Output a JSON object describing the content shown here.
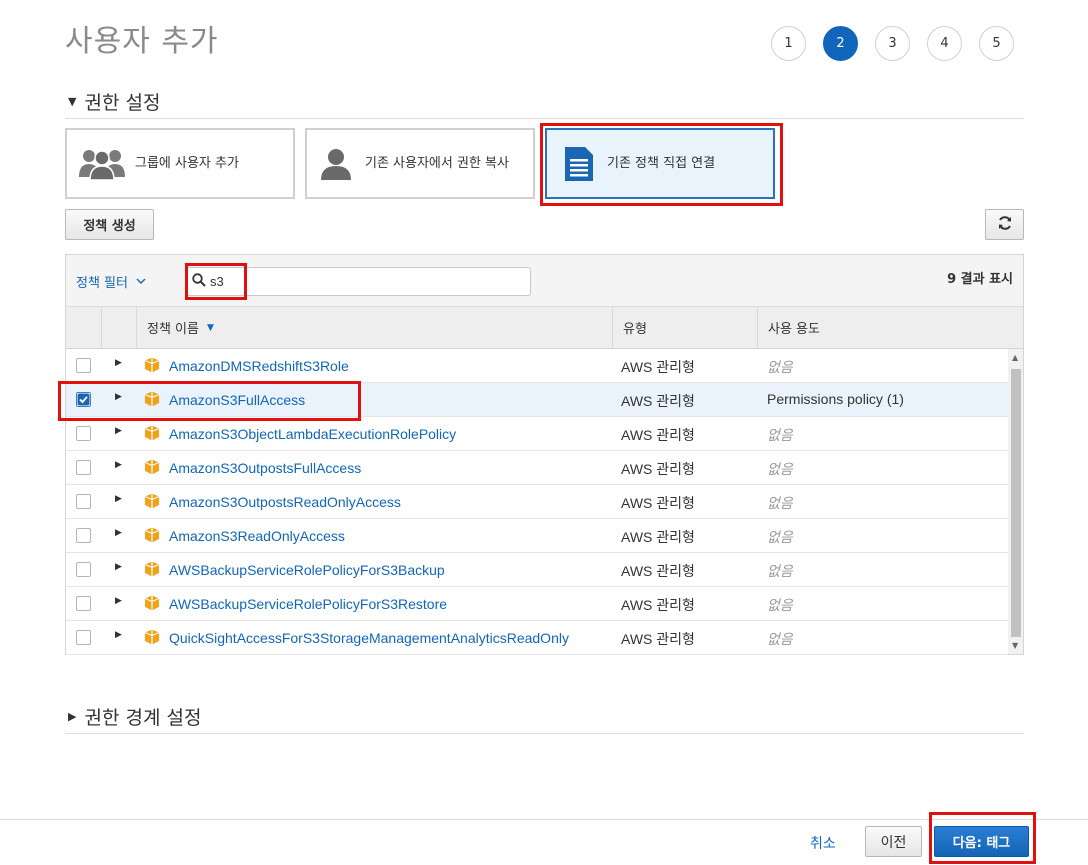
{
  "page": {
    "title": "사용자 추가"
  },
  "steps": [
    "1",
    "2",
    "3",
    "4",
    "5"
  ],
  "current_step": "2",
  "permissions": {
    "section_title": "권한 설정",
    "options": [
      {
        "label": "그룹에 사용자 추가",
        "icon": "group-icon"
      },
      {
        "label": "기존 사용자에서 권한 복사",
        "icon": "user-icon"
      },
      {
        "label": "기존 정책 직접 연결",
        "icon": "document-icon",
        "selected": true
      }
    ],
    "create_policy_label": "정책 생성",
    "refresh_icon": "refresh-icon"
  },
  "filter": {
    "label": "정책 필터",
    "search_value": "s3",
    "results_text": "9 결과 표시"
  },
  "table": {
    "columns": [
      "정책 이름",
      "유형",
      "사용 용도"
    ],
    "rows": [
      {
        "name": "AmazonDMSRedshiftS3Role",
        "type": "AWS 관리형",
        "usage": "없음",
        "checked": false
      },
      {
        "name": "AmazonS3FullAccess",
        "type": "AWS 관리형",
        "usage": "Permissions policy (1)",
        "checked": true
      },
      {
        "name": "AmazonS3ObjectLambdaExecutionRolePolicy",
        "type": "AWS 관리형",
        "usage": "없음",
        "checked": false
      },
      {
        "name": "AmazonS3OutpostsFullAccess",
        "type": "AWS 관리형",
        "usage": "없음",
        "checked": false
      },
      {
        "name": "AmazonS3OutpostsReadOnlyAccess",
        "type": "AWS 관리형",
        "usage": "없음",
        "checked": false
      },
      {
        "name": "AmazonS3ReadOnlyAccess",
        "type": "AWS 관리형",
        "usage": "없음",
        "checked": false
      },
      {
        "name": "AWSBackupServiceRolePolicyForS3Backup",
        "type": "AWS 관리형",
        "usage": "없음",
        "checked": false
      },
      {
        "name": "AWSBackupServiceRolePolicyForS3Restore",
        "type": "AWS 관리형",
        "usage": "없음",
        "checked": false
      },
      {
        "name": "QuickSightAccessForS3StorageManagementAnalyticsReadOnly",
        "type": "AWS 관리형",
        "usage": "없음",
        "checked": false
      }
    ]
  },
  "boundary": {
    "section_title": "권한 경계 설정"
  },
  "footer": {
    "cancel_label": "취소",
    "previous_label": "이전",
    "next_label": "다음: 태그"
  },
  "colors": {
    "accent": "#1166bb",
    "highlight": "#e01010",
    "policy_icon": "#f0a21b"
  }
}
